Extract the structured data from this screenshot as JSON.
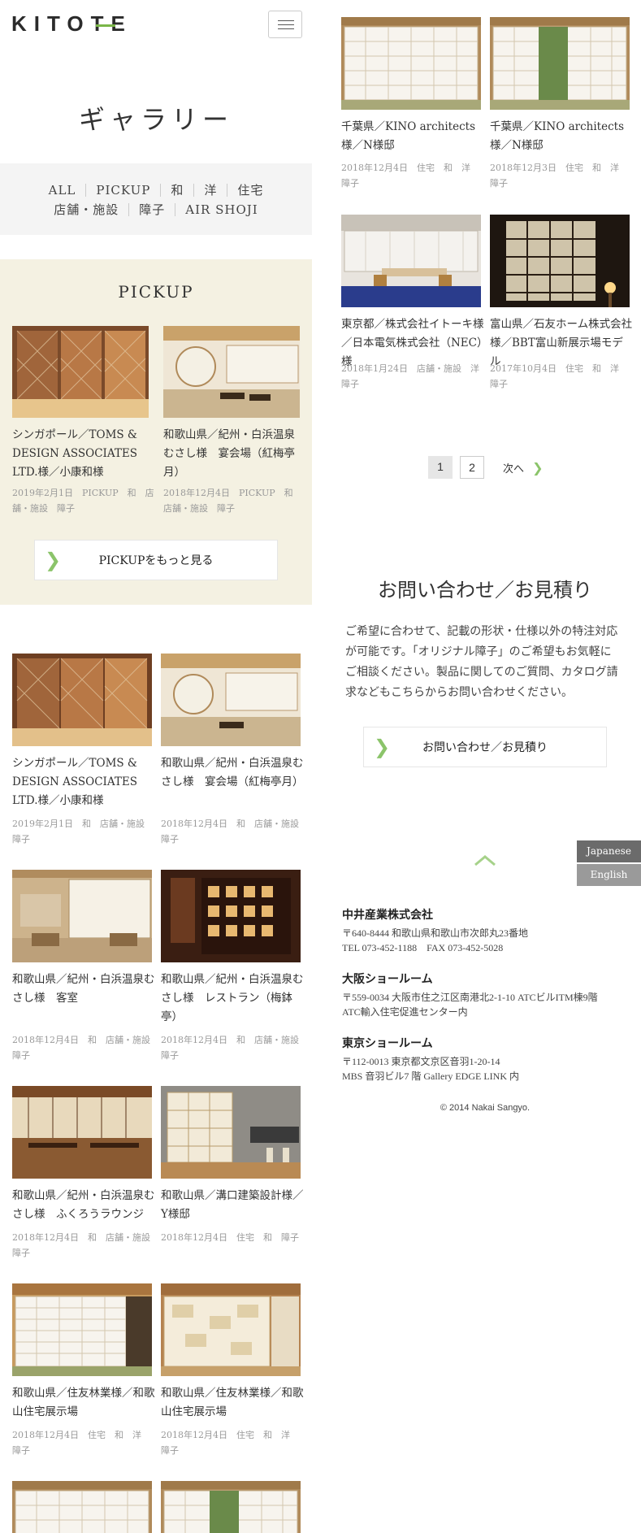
{
  "header": {
    "logo_text": "KITOTE",
    "menu_label": ""
  },
  "page_title": "ギャラリー",
  "filters": {
    "row1": [
      "ALL",
      "PICKUP",
      "和",
      "洋",
      "住宅"
    ],
    "row2": [
      "店舗・施設",
      "障子",
      "AIR SHOJI"
    ]
  },
  "pickup": {
    "title": "PICKUP",
    "items": [
      {
        "title": "シンガポール／TOMS & DESIGN ASSOCIATES LTD.様／小康和様",
        "meta": "2019年2月1日　PICKUP　和　店舗・施設　障子"
      },
      {
        "title": "和歌山県／紀州・白浜温泉むさし様　宴会場（紅梅亭月）",
        "meta": "2018年12月4日　PICKUP　和　店舗・施設　障子"
      }
    ],
    "more_label": "PICKUPをもっと見る"
  },
  "gallery_left": [
    {
      "title": "シンガポール／TOMS & DESIGN ASSOCIATES LTD.様／小康和様",
      "meta": "2019年2月1日　和　店舗・施設　障子"
    },
    {
      "title": "和歌山県／紀州・白浜温泉むさし様　宴会場（紅梅亭月）",
      "meta": "2018年12月4日　和　店舗・施設　障子"
    },
    {
      "title": "和歌山県／紀州・白浜温泉むさし様　客室",
      "meta": "2018年12月4日　和　店舗・施設　障子"
    },
    {
      "title": "和歌山県／紀州・白浜温泉むさし様　レストラン（梅鉢亭）",
      "meta": "2018年12月4日　和　店舗・施設　障子"
    },
    {
      "title": "和歌山県／紀州・白浜温泉むさし様　ふくろうラウンジ",
      "meta": "2018年12月4日　和　店舗・施設　障子"
    },
    {
      "title": "和歌山県／溝口建築設計様／Y様邸",
      "meta": "2018年12月4日　住宅　和　障子"
    },
    {
      "title": "和歌山県／住友林業様／和歌山住宅展示場",
      "meta": "2018年12月4日　住宅　和　洋　障子"
    },
    {
      "title": "和歌山県／住友林業様／和歌山住宅展示場",
      "meta": "2018年12月4日　住宅　和　洋　障子"
    }
  ],
  "gallery_right": [
    {
      "title": "千葉県／KINO architects様／N様邸",
      "meta": "2018年12月4日　住宅　和　洋　障子"
    },
    {
      "title": "千葉県／KINO architects様／N様邸",
      "meta": "2018年12月3日　住宅　和　洋　障子"
    },
    {
      "title": "東京都／株式会社イトーキ様／日本電気株式会社（NEC）様",
      "meta": "2018年1月24日　店舗・施設　洋　障子"
    },
    {
      "title": "富山県／石友ホーム株式会社様／BBT富山新展示場モデル",
      "meta": "2017年10月4日　住宅　和　洋　障子"
    }
  ],
  "pagination": {
    "pages": [
      "1",
      "2"
    ],
    "current": "1",
    "next_label": "次へ"
  },
  "contact": {
    "title": "お問い合わせ／お見積り",
    "text": "ご希望に合わせて、記載の形状・仕様以外の特注対応が可能です。「オリジナル障子」のご希望もお気軽にご相談ください。製品に関してのご質問、カタログ請求などもこちらからお問い合わせください。",
    "button_label": "お問い合わせ／お見積り"
  },
  "language": {
    "japanese": "Japanese",
    "english": "English"
  },
  "offices": [
    {
      "name": "中井産業株式会社",
      "line1": "〒640-8444 和歌山県和歌山市次郎丸23番地",
      "line2": "TEL 073-452-1188　FAX 073-452-5028"
    },
    {
      "name": "大阪ショールーム",
      "line1": "〒559-0034 大阪市住之江区南港北2-1-10 ATCビルITM棟9階",
      "line2": "ATC輸入住宅促進センター内"
    },
    {
      "name": "東京ショールーム",
      "line1": "〒112-0013 東京都文京区音羽1-20-14",
      "line2": "MBS 音羽ビル7 階 Gallery EDGE LINK 内"
    }
  ],
  "copyright": "© 2014 Nakai Sangyo.",
  "colors": {
    "accent_green": "#8bc46a",
    "pickup_bg": "#f4f1e2",
    "filter_bg": "#f4f4f4",
    "lang_japanese_bg": "#6b6b6b",
    "lang_english_bg": "#9a9a9a"
  }
}
